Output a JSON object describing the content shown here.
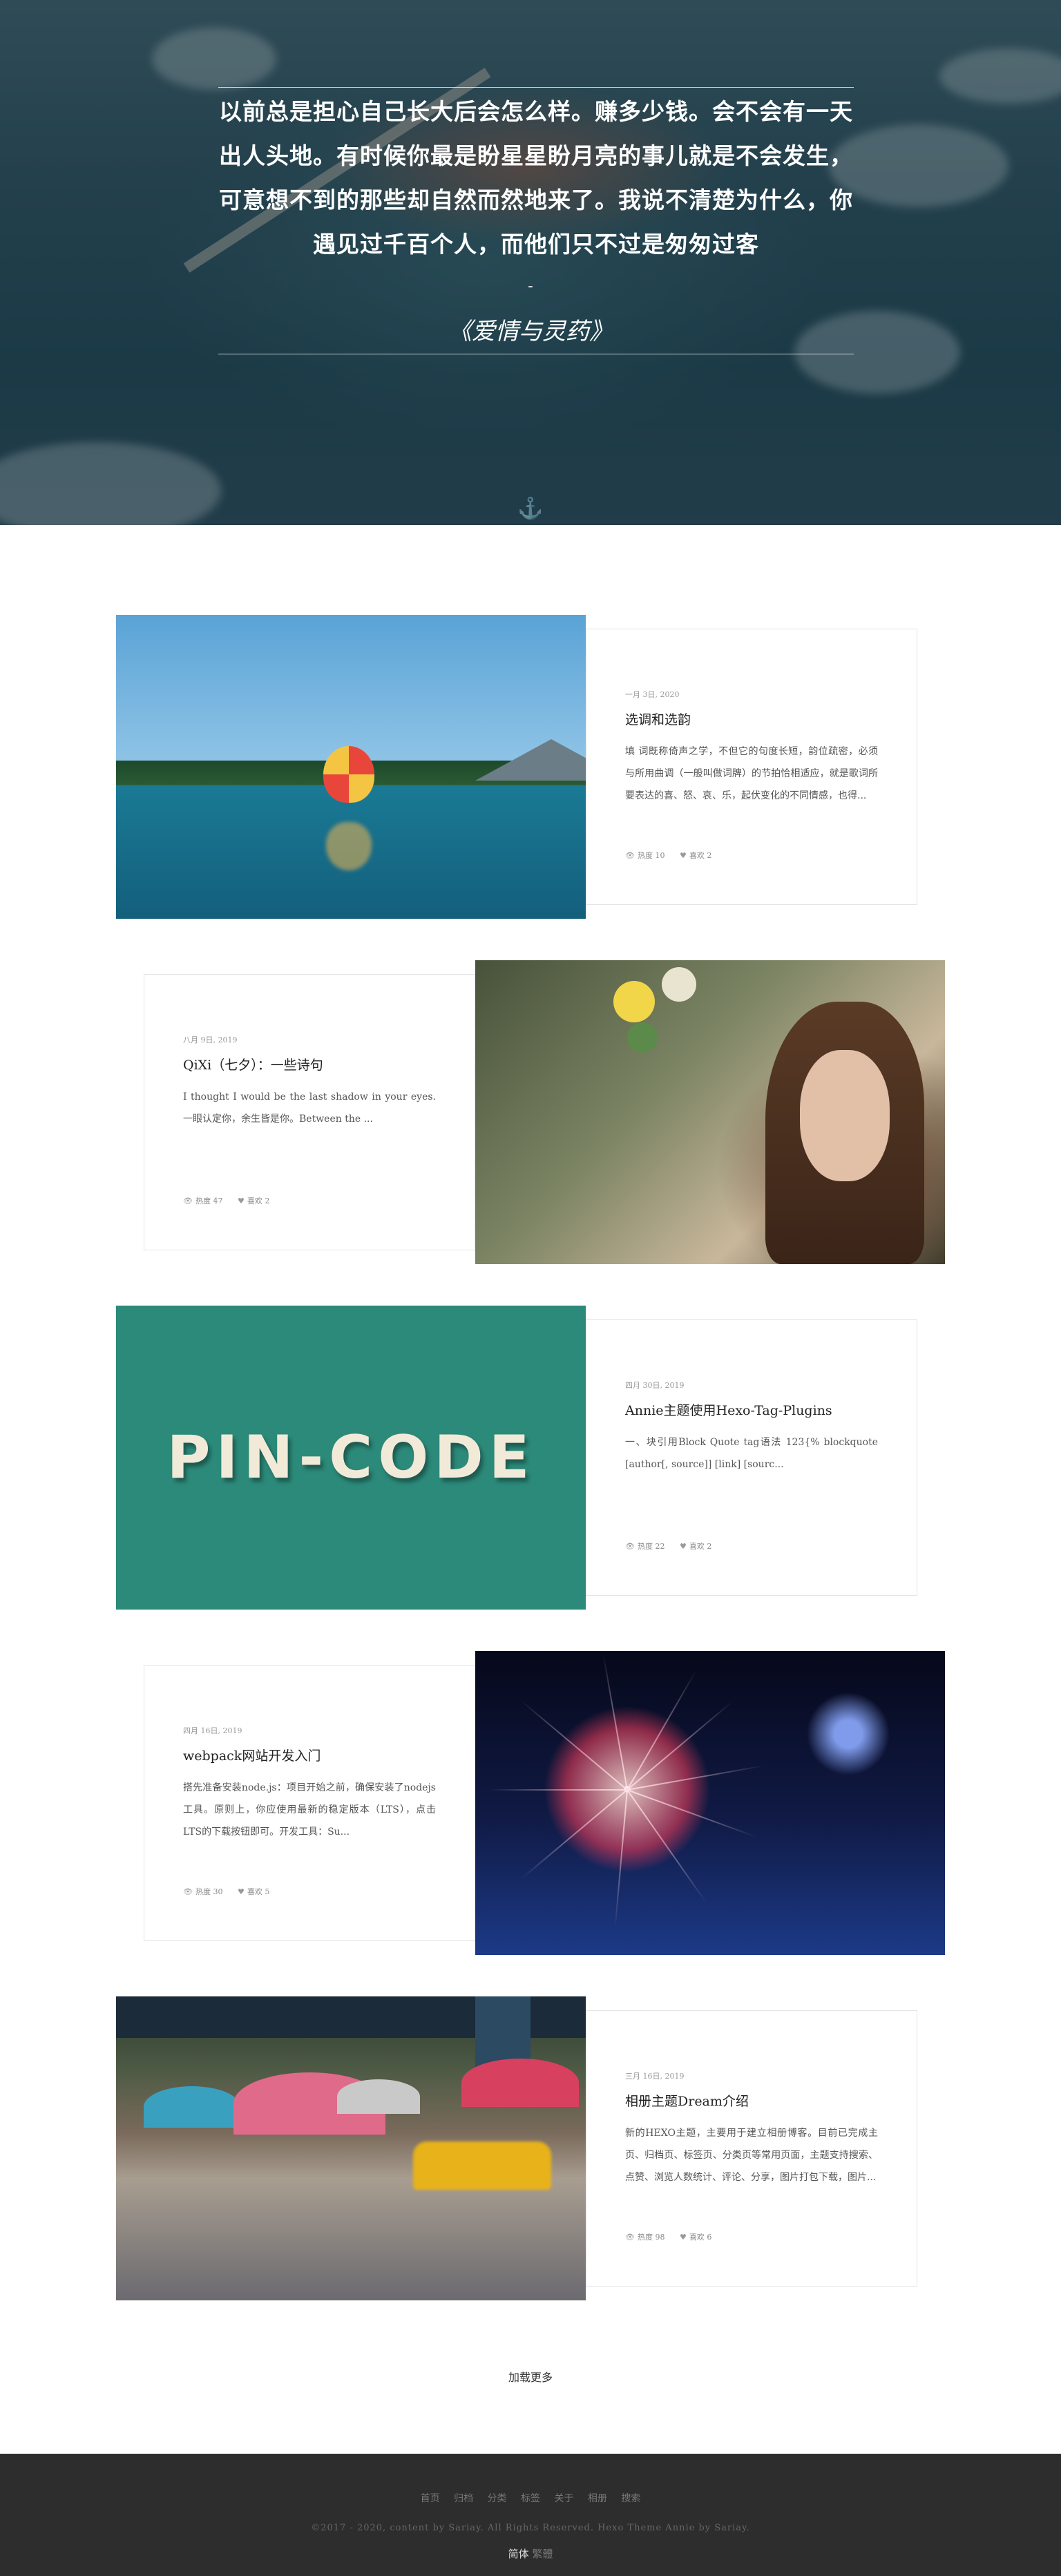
{
  "hero": {
    "quote": "以前总是担心自己长大后会怎么样。赚多少钱。会不会有一天出人头地。有时候你最是盼星星盼月亮的事儿就是不会发生，可意想不到的那些却自然而然地来了。我说不清楚为什么，你遇见过千百个人，而他们只不过是匆匆过客",
    "dash": "-",
    "source": "《爱情与灵药》"
  },
  "posts": [
    {
      "date": "一月 3日, 2020",
      "title": "选调和选韵",
      "excerpt": "填 词既称倚声之学，不但它的句度长短，韵位疏密，必须与所用曲调（一般叫做词牌）的节拍恰相适应，就是歌词所要表达的喜、怒、哀、乐，起伏变化的不同情感，也得...",
      "views": "热度 10",
      "likes": "喜欢 2"
    },
    {
      "date": "八月 9日, 2019",
      "title": "QiXi（七夕）：一些诗句",
      "excerpt": "I thought I would be the last shadow in your eyes. 一眼认定你，余生皆是你。Between the ...",
      "views": "热度 47",
      "likes": "喜欢 2"
    },
    {
      "date": "四月 30日, 2019",
      "title": "Annie主题使用Hexo-Tag-Plugins",
      "excerpt": "一、块引用Block Quote tag语法 123{% blockquote [author[, source]] [link] [sourc...",
      "views": "热度 22",
      "likes": "喜欢 2"
    },
    {
      "date": "四月 16日, 2019",
      "title": "webpack网站开发入门",
      "excerpt": "搭先准备安装node.js：项目开始之前，确保安装了nodejs工具。原则上，你应使用最新的稳定版本（LTS），点击LTS的下载按钮即可。开发工具：Su...",
      "views": "热度 30",
      "likes": "喜欢 5"
    },
    {
      "date": "三月 16日, 2019",
      "title": "相册主题Dream介绍",
      "excerpt": "新的HEXO主题，主要用于建立相册博客。目前已完成主页、归档页、标签页、分类页等常用页面，主题支持搜索、点赞、浏览人数统计、评论、分享，图片打包下载，图片...",
      "views": "热度 98",
      "likes": "喜欢 6"
    }
  ],
  "thumbs": {
    "pin_text": "PIN-CODE"
  },
  "load_more": "加载更多",
  "footer": {
    "nav": [
      "首页",
      "归档",
      "分类",
      "标签",
      "关于",
      "相册",
      "搜索"
    ],
    "copyright": "©2017 - 2020, content by Sariay. All Rights Reserved. Hexo Theme Annie by Sariay.",
    "lang_active": "简体",
    "lang_other": "繁體"
  },
  "colors": {
    "footer_bg": "#2d2d2d",
    "card_border": "#e4e4e4"
  }
}
